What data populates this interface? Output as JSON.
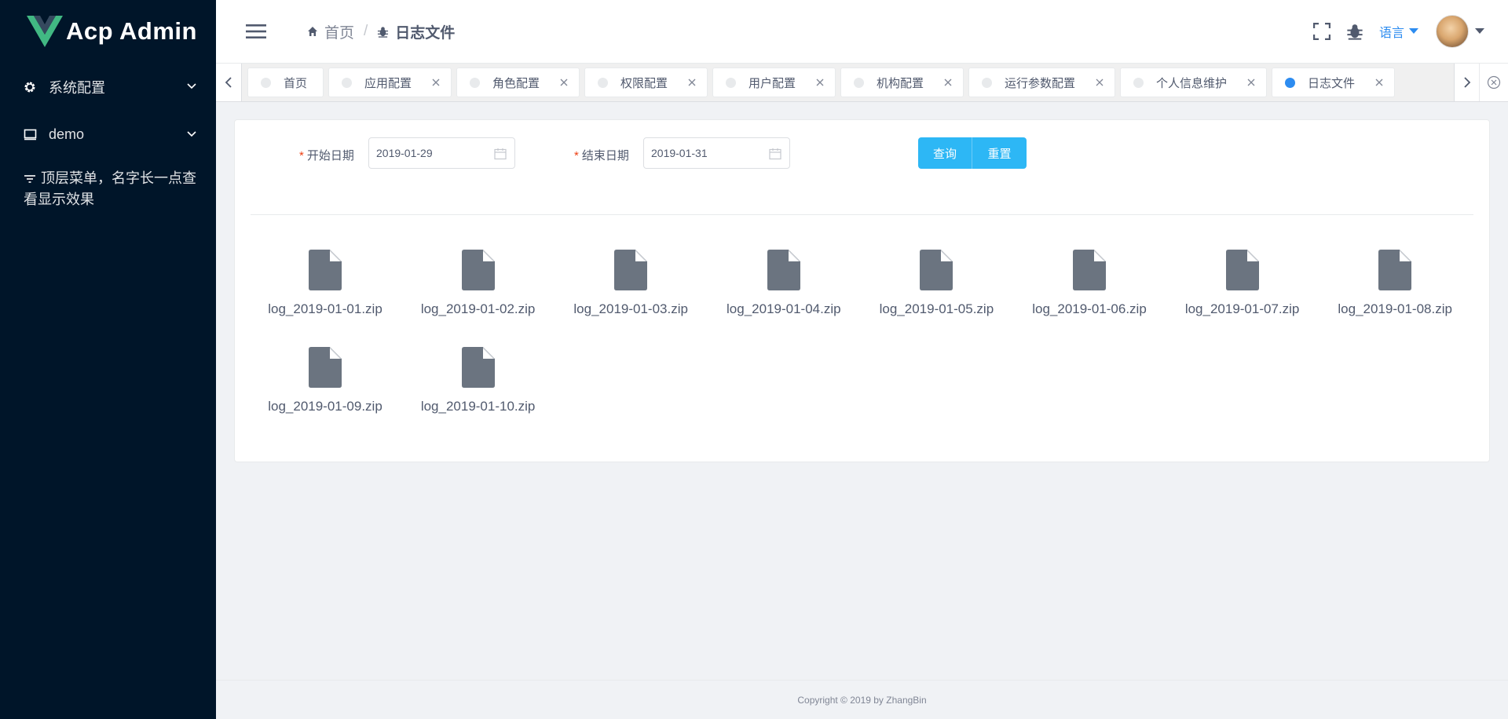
{
  "app": {
    "logo_text": "Acp Admin"
  },
  "sidebar": {
    "items": [
      {
        "label": "系统配置",
        "icon": "gear-icon"
      },
      {
        "label": "demo",
        "icon": "monitor-icon"
      },
      {
        "label": "顶层菜单，名字长一点查看显示效果",
        "icon": "filter-icon"
      }
    ]
  },
  "breadcrumb": [
    {
      "label": "首页",
      "icon": "home-icon"
    },
    {
      "label": "日志文件",
      "icon": "bug-icon"
    }
  ],
  "header": {
    "language_label": "语言"
  },
  "tabs": [
    {
      "label": "首页",
      "closable": false
    },
    {
      "label": "应用配置",
      "closable": true
    },
    {
      "label": "角色配置",
      "closable": true
    },
    {
      "label": "权限配置",
      "closable": true
    },
    {
      "label": "用户配置",
      "closable": true
    },
    {
      "label": "机构配置",
      "closable": true
    },
    {
      "label": "运行参数配置",
      "closable": true
    },
    {
      "label": "个人信息维护",
      "closable": true
    },
    {
      "label": "日志文件",
      "closable": true,
      "active": true
    }
  ],
  "form": {
    "start_label": "开始日期",
    "start_value": "2019-01-29",
    "end_label": "结束日期",
    "end_value": "2019-01-31",
    "required_mark": "*",
    "query_button": "查询",
    "reset_button": "重置"
  },
  "files": [
    "log_2019-01-01.zip",
    "log_2019-01-02.zip",
    "log_2019-01-03.zip",
    "log_2019-01-04.zip",
    "log_2019-01-05.zip",
    "log_2019-01-06.zip",
    "log_2019-01-07.zip",
    "log_2019-01-08.zip",
    "log_2019-01-09.zip",
    "log_2019-01-10.zip"
  ],
  "footer": {
    "copyright": "Copyright © 2019 by ZhangBin"
  },
  "colors": {
    "sidebar_bg": "#001529",
    "accent": "#2d8cf0",
    "button": "#2db7f5",
    "file_icon": "#6b7480"
  }
}
